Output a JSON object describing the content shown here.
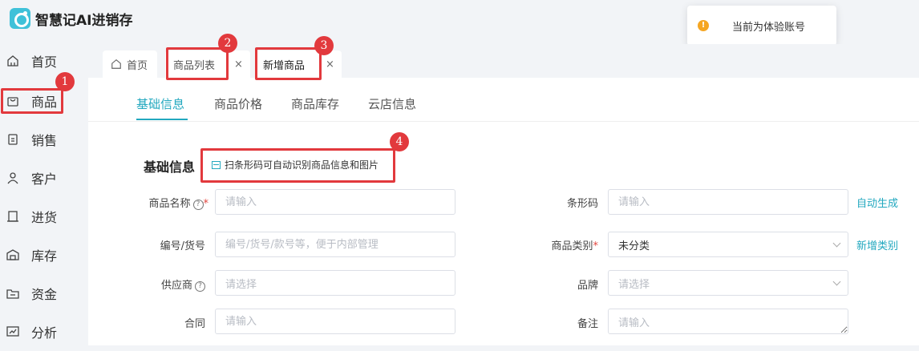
{
  "app": {
    "title": "智慧记AI进销存"
  },
  "toast": {
    "message": "当前为体验账号",
    "icon": "warning-icon"
  },
  "sidebar": {
    "items": [
      {
        "label": "首页",
        "icon": "home-icon"
      },
      {
        "label": "商品",
        "icon": "bag-icon"
      },
      {
        "label": "销售",
        "icon": "clipboard-icon"
      },
      {
        "label": "客户",
        "icon": "user-icon"
      },
      {
        "label": "进货",
        "icon": "book-icon"
      },
      {
        "label": "库存",
        "icon": "warehouse-icon"
      },
      {
        "label": "资金",
        "icon": "folder-icon"
      },
      {
        "label": "分析",
        "icon": "chart-icon"
      }
    ]
  },
  "tabs": {
    "home": "首页",
    "list": "商品列表",
    "new": "新增商品",
    "close": "×"
  },
  "subtabs": [
    "基础信息",
    "商品价格",
    "商品库存",
    "云店信息"
  ],
  "section": {
    "title": "基础信息",
    "scan_label": "扫条形码可自动识别商品信息和图片"
  },
  "form": {
    "name": {
      "label": "商品名称",
      "placeholder": "请输入"
    },
    "barcode": {
      "label": "条形码",
      "placeholder": "请输入",
      "action": "自动生成"
    },
    "code": {
      "label": "编号/货号",
      "placeholder": "编号/货号/款号等，便于内部管理"
    },
    "category": {
      "label": "商品类别",
      "value": "未分类",
      "action": "新增类别"
    },
    "supplier": {
      "label": "供应商",
      "placeholder": "请选择"
    },
    "brand": {
      "label": "品牌",
      "placeholder": "请选择"
    },
    "contract": {
      "label": "合同",
      "placeholder": "请输入"
    },
    "remark": {
      "label": "备注",
      "placeholder": "请输入"
    }
  },
  "annotations": [
    "1",
    "2",
    "3",
    "4"
  ],
  "colors": {
    "accent": "#22a8bf",
    "annotation": "#e2393d",
    "required": "#e2463f"
  }
}
